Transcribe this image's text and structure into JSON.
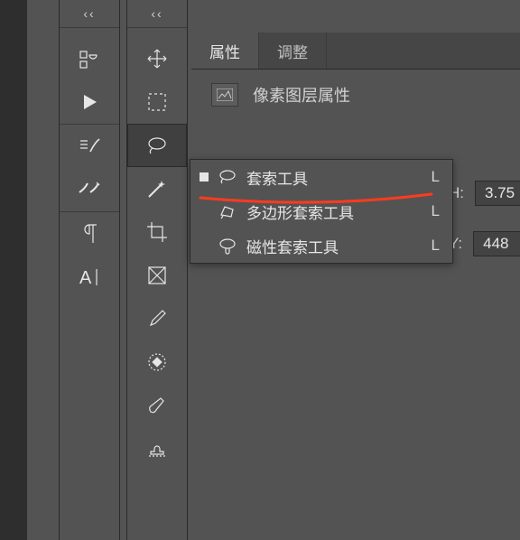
{
  "panels": {
    "panelA": {
      "collapse_label": "‹‹"
    },
    "panelB": {
      "collapse_label": "‹‹"
    }
  },
  "tabs": {
    "properties": "属性",
    "adjustments": "调整"
  },
  "propHeader": {
    "title": "像素图层属性"
  },
  "fields": {
    "h_label": "H:",
    "h_value": "3.75",
    "y_label": "Y:",
    "y_value": "448"
  },
  "toolbarA": {
    "items": [
      {
        "name": "plugins-icon"
      },
      {
        "name": "play-icon"
      },
      {
        "name": "history-brush-icon"
      },
      {
        "name": "brush-settings-icon"
      },
      {
        "name": "paragraph-icon"
      },
      {
        "name": "text-tool-icon"
      }
    ]
  },
  "toolbarB": {
    "items": [
      {
        "name": "move-tool-icon"
      },
      {
        "name": "marquee-tool-icon"
      },
      {
        "name": "lasso-tool-icon",
        "active": true
      },
      {
        "name": "magic-wand-icon"
      },
      {
        "name": "crop-tool-icon"
      },
      {
        "name": "frame-tool-icon"
      },
      {
        "name": "eyedropper-icon"
      },
      {
        "name": "healing-brush-icon"
      },
      {
        "name": "brush-tool-icon"
      },
      {
        "name": "stamp-tool-icon"
      }
    ]
  },
  "flyout": {
    "items": [
      {
        "name": "lasso-tool",
        "label": "套索工具",
        "key": "L",
        "selected": true,
        "icon": "lasso"
      },
      {
        "name": "poly-lasso-tool",
        "label": "多边形套索工具",
        "key": "L",
        "selected": false,
        "icon": "poly"
      },
      {
        "name": "magnetic-lasso-tool",
        "label": "磁性套索工具",
        "key": "L",
        "selected": false,
        "icon": "magnet"
      }
    ]
  }
}
